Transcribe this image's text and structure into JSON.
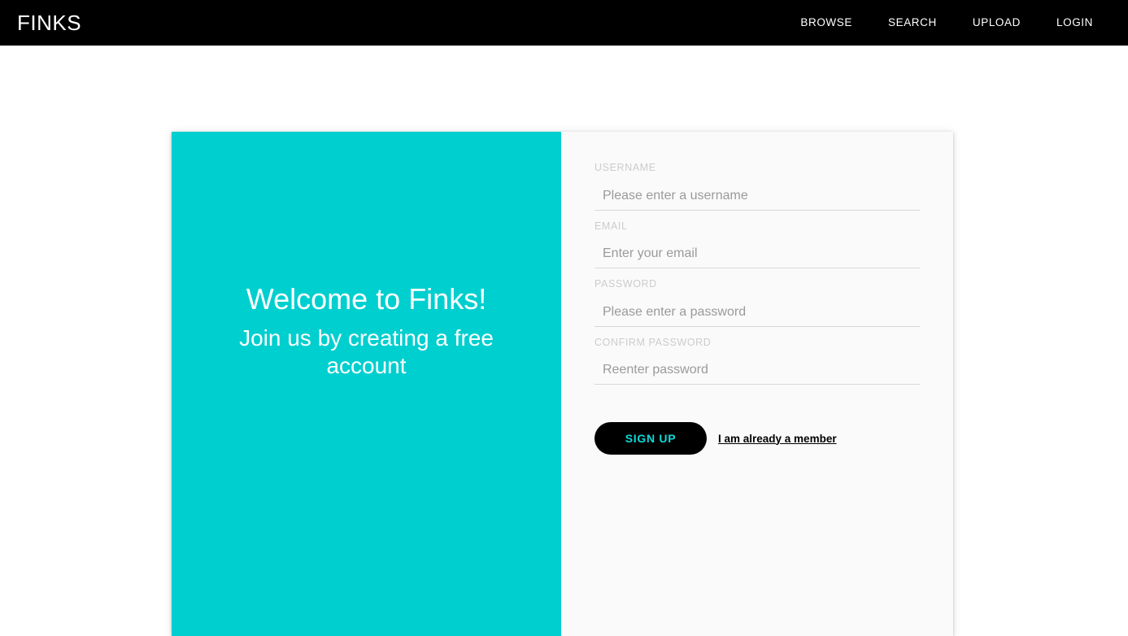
{
  "navbar": {
    "brand": "FINKS",
    "links": [
      {
        "label": "BROWSE",
        "name": "nav-link-browse"
      },
      {
        "label": "SEARCH",
        "name": "nav-link-search"
      },
      {
        "label": "UPLOAD",
        "name": "nav-link-upload"
      },
      {
        "label": "LOGIN",
        "name": "nav-link-login"
      }
    ],
    "background_color": "#000000",
    "text_color": "#ffffff"
  },
  "hero": {
    "title": "Welcome to Finks!",
    "subtitle": "Join us by creating a free account",
    "background_color": "#00cfcf",
    "text_color": "#ffffff"
  },
  "form": {
    "panel_background": "#fafafa",
    "fields": {
      "username": {
        "label": "USERNAME",
        "placeholder": "Please enter a username",
        "value": ""
      },
      "email": {
        "label": "EMAIL",
        "placeholder": "Enter your email",
        "value": ""
      },
      "password": {
        "label": "PASSWORD",
        "placeholder": "Please enter a password",
        "value": ""
      },
      "confirm_password": {
        "label": "CONFIRM PASSWORD",
        "placeholder": "Reenter password",
        "value": ""
      }
    },
    "submit_label": "SIGN UP",
    "submit_background": "#000000",
    "submit_text_color": "#0dd9d9",
    "member_link_label": "I am already a member"
  }
}
